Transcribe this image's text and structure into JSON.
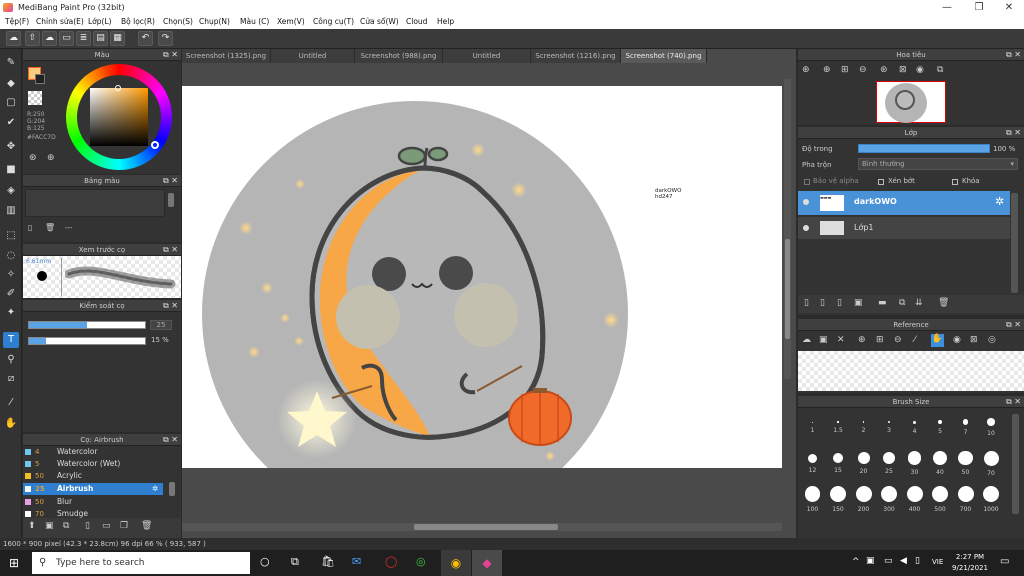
{
  "window": {
    "title": "MediBang Paint Pro (32bit)"
  },
  "menu": [
    "Tệp(F)",
    "Chỉnh sửa(E)",
    "Lớp(L)",
    "Bộ lọc(R)",
    "Chọn(S)",
    "Chụp(N)",
    "Màu (C)",
    "Xem(V)",
    "Công cụ(T)",
    "Cửa sổ(W)",
    "Cloud",
    "Help"
  ],
  "tabs": [
    "Screenshot (1325).png",
    "Untitled",
    "Screenshot (988).png",
    "Untitled",
    "Screenshot (1216).png",
    "Screenshot (740).png"
  ],
  "color_panel": {
    "title": "Màu",
    "r": "R:250",
    "g": "G:204",
    "b": "B:125",
    "hex": "#FACC7D"
  },
  "palette_panel": {
    "title": "Bảng màu",
    "dash": "---"
  },
  "preview_panel": {
    "title": "Xem trước cọ",
    "size": "6.61mm"
  },
  "brush_control": {
    "title": "Kiểm soát cọ",
    "size": "25",
    "opacity": "15 %",
    "size_value": 0.5,
    "opacity_value": 0.15
  },
  "brush_list": {
    "title": "Cọ: Airbrush",
    "items": [
      {
        "num": "4",
        "name": "Watercolor",
        "color": "#6ec6f0"
      },
      {
        "num": "5",
        "name": "Watercolor (Wet)",
        "color": "#6ec6f0"
      },
      {
        "num": "50",
        "name": "Acrylic",
        "color": "#f0c020"
      },
      {
        "num": "25",
        "name": "Airbrush",
        "color": "#f5f5f5"
      },
      {
        "num": "50",
        "name": "Blur",
        "color": "#e6a0e0"
      },
      {
        "num": "70",
        "name": "Smudge",
        "color": "#ffffff"
      }
    ]
  },
  "navigator": {
    "title": "Hoa tiêu"
  },
  "layer_panel": {
    "title": "Lớp",
    "opacity_label": "Độ trong",
    "opacity_value": "100 %",
    "blend_label": "Pha trộn",
    "blend_value": "Bình thường",
    "opt_alpha": "Bảo vệ alpha",
    "opt_clip": "Xén bớt",
    "opt_lock": "Khóa",
    "layers": [
      {
        "name": "darkOWO",
        "selected": true
      },
      {
        "name": "Lớp1",
        "selected": false
      }
    ]
  },
  "reference": {
    "title": "Reference"
  },
  "brush_size": {
    "title": "Brush Size",
    "sizes": [
      "1",
      "1.5",
      "2",
      "3",
      "4",
      "5",
      "7",
      "10",
      "12",
      "15",
      "20",
      "25",
      "30",
      "40",
      "50",
      "70",
      "100",
      "150",
      "200",
      "300",
      "400",
      "500",
      "700",
      "1000"
    ]
  },
  "canvas_text": {
    "line1": "darkOWO",
    "line2": "hd247"
  },
  "status": {
    "text": "1600 * 900 pixel  (42.3 * 23.8cm)  96 dpi  66 %  ( 933, 587 )"
  },
  "taskbar": {
    "search_placeholder": "Type here to search",
    "time": "2:27 PM",
    "date": "9/21/2021",
    "lang": "VIE"
  }
}
